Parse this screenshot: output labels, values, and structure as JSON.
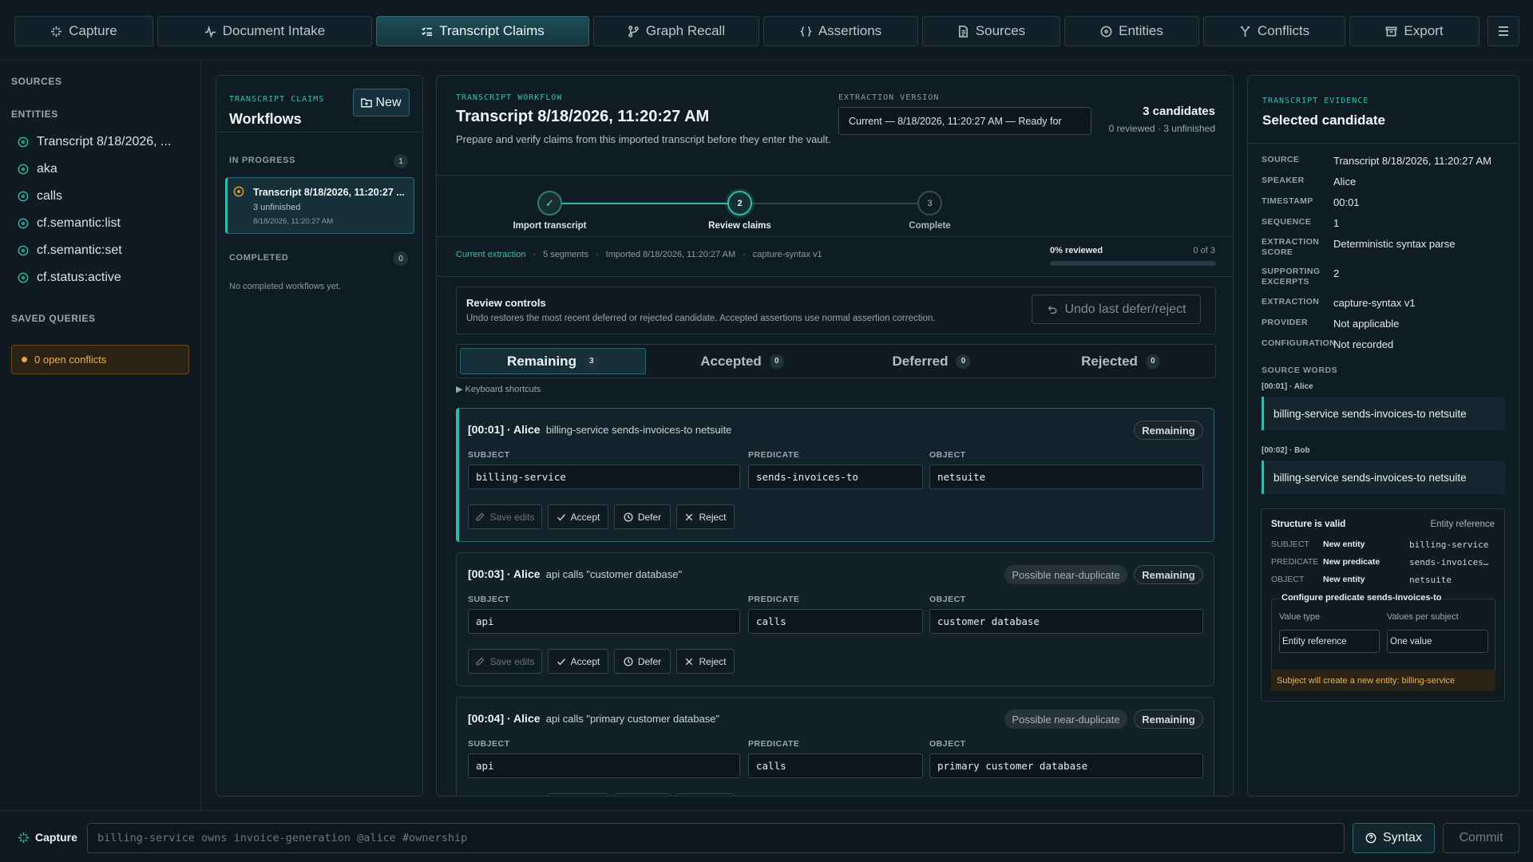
{
  "nav": {
    "tabs": [
      {
        "label": "Capture",
        "icon": "sparkle-icon"
      },
      {
        "label": "Document Intake",
        "icon": "pulse-icon"
      },
      {
        "label": "Transcript Claims",
        "icon": "list-check-icon"
      },
      {
        "label": "Graph Recall",
        "icon": "branch-icon"
      },
      {
        "label": "Assertions",
        "icon": "braces-icon"
      },
      {
        "label": "Sources",
        "icon": "document-icon"
      },
      {
        "label": "Entities",
        "icon": "target-icon"
      },
      {
        "label": "Conflicts",
        "icon": "fork-icon"
      },
      {
        "label": "Export",
        "icon": "archive-icon"
      }
    ],
    "active": "Transcript Claims"
  },
  "sidebar": {
    "sources_heading": "SOURCES",
    "entities_heading": "ENTITIES",
    "entities": [
      "Transcript 8/18/2026, ...",
      "aka",
      "calls",
      "cf.semantic:list",
      "cf.semantic:set",
      "cf.status:active"
    ],
    "saved_queries_heading": "SAVED QUERIES",
    "conflicts_label": "0 open conflicts"
  },
  "workflows": {
    "eyebrow": "TRANSCRIPT CLAIMS",
    "title": "Workflows",
    "new_label": "New",
    "in_progress_heading": "IN PROGRESS",
    "in_progress_count": "1",
    "item": {
      "title": "Transcript 8/18/2026, 11:20:27 ...",
      "status": "3 unfinished",
      "date": "8/18/2026, 11:20:27 AM"
    },
    "completed_heading": "COMPLETED",
    "completed_count": "0",
    "completed_empty": "No completed workflows yet."
  },
  "workflow": {
    "eyebrow": "TRANSCRIPT WORKFLOW",
    "title": "Transcript 8/18/2026, 11:20:27 AM",
    "description": "Prepare and verify claims from this imported transcript before they enter the vault.",
    "version_label": "EXTRACTION VERSION",
    "version_value": "Current — 8/18/2026, 11:20:27 AM — Ready for",
    "candidates": "3 candidates",
    "candidates_sub": "0 reviewed · 3 unfinished",
    "steps": [
      {
        "num": "✓",
        "label": "Import transcript"
      },
      {
        "num": "2",
        "label": "Review claims"
      },
      {
        "num": "3",
        "label": "Complete"
      }
    ],
    "meta": {
      "current": "Current extraction",
      "segments": "5 segments",
      "imported": "Imported 8/18/2026, 11:20:27 AM",
      "parser": "capture-syntax v1",
      "reviewed_label": "0% reviewed",
      "reviewed_count": "0 of 3",
      "reviewed_fraction": 0
    },
    "review_controls": {
      "title": "Review controls",
      "desc": "Undo restores the most recent deferred or rejected candidate. Accepted assertions use normal assertion correction.",
      "undo_label": "Undo last defer/reject"
    },
    "filters": [
      {
        "label": "Remaining",
        "count": "3"
      },
      {
        "label": "Accepted",
        "count": "0"
      },
      {
        "label": "Deferred",
        "count": "0"
      },
      {
        "label": "Rejected",
        "count": "0"
      }
    ],
    "shortcuts": "▶ Keyboard shortcuts",
    "labels": {
      "subject": "SUBJECT",
      "predicate": "PREDICATE",
      "object": "OBJECT",
      "save": "Save edits",
      "accept": "Accept",
      "defer": "Defer",
      "reject": "Reject",
      "remaining": "Remaining",
      "near_dup": "Possible near-duplicate"
    },
    "claims": [
      {
        "time": "[00:01] · Alice",
        "text": "billing-service sends-invoices-to netsuite",
        "subject": "billing-service",
        "predicate": "sends-invoices-to",
        "object": "netsuite"
      },
      {
        "time": "[00:03] · Alice",
        "text": "api calls \"customer database\"",
        "subject": "api",
        "predicate": "calls",
        "object": "customer database"
      },
      {
        "time": "[00:04] · Alice",
        "text": "api calls \"primary customer database\"",
        "subject": "api",
        "predicate": "calls",
        "object": "primary customer database"
      }
    ]
  },
  "evidence": {
    "eyebrow": "TRANSCRIPT EVIDENCE",
    "title": "Selected candidate",
    "fields": [
      {
        "k": "SOURCE",
        "v": "Transcript 8/18/2026, 11:20:27 AM"
      },
      {
        "k": "SPEAKER",
        "v": "Alice"
      },
      {
        "k": "TIMESTAMP",
        "v": "00:01"
      },
      {
        "k": "SEQUENCE",
        "v": "1"
      },
      {
        "k": "EXTRACTION SCORE",
        "v": "Deterministic syntax parse"
      },
      {
        "k": "SUPPORTING EXCERPTS",
        "v": "2"
      },
      {
        "k": "EXTRACTION",
        "v": "capture-syntax v1"
      },
      {
        "k": "PROVIDER",
        "v": "Not applicable"
      },
      {
        "k": "CONFIGURATION",
        "v": "Not recorded"
      }
    ],
    "source_words_heading": "SOURCE WORDS",
    "words": [
      {
        "who": "[00:01] · Alice",
        "text": "billing-service sends-invoices-to netsuite"
      },
      {
        "who": "[00:02] · Bob",
        "text": "billing-service sends-invoices-to netsuite"
      }
    ],
    "structure": {
      "title": "Structure is valid",
      "type": "Entity reference",
      "rows": [
        {
          "k": "SUBJECT",
          "state": "New entity",
          "val": "billing-service"
        },
        {
          "k": "PREDICATE",
          "state": "New predicate",
          "val": "sends-invoices…"
        },
        {
          "k": "OBJECT",
          "state": "New entity",
          "val": "netsuite"
        }
      ],
      "configure_title": "Configure predicate sends-invoices-to",
      "value_type_label": "Value type",
      "value_type": "Entity reference",
      "per_subject_label": "Values per subject",
      "per_subject": "One value",
      "warning": "Subject will create a new entity: billing-service"
    }
  },
  "bottombar": {
    "label": "Capture",
    "placeholder": "billing-service owns invoice-generation @alice #ownership",
    "syntax_label": "Syntax",
    "commit_label": "Commit"
  },
  "colors": {
    "accent": "#2fb9a9",
    "warning": "#e9a23b",
    "background": "#0f1a21"
  }
}
